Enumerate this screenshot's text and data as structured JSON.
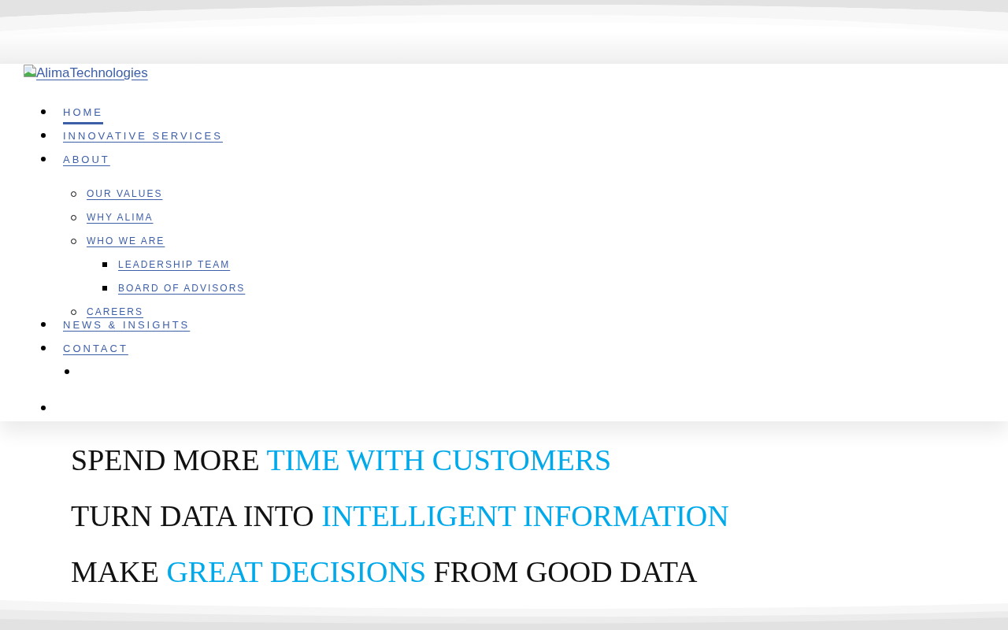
{
  "logo": {
    "alt_text": "AlimaTechnologies"
  },
  "nav": {
    "items": [
      {
        "kind": "link",
        "label": "HOME",
        "selected": true
      },
      {
        "kind": "link",
        "label": "INNOVATIVE SERVICES",
        "selected": false
      },
      {
        "kind": "link",
        "label": "ABOUT",
        "selected": false,
        "children": [
          {
            "kind": "link",
            "label": "OUR VALUES",
            "selected": false
          },
          {
            "kind": "link",
            "label": "WHY ALIMA",
            "selected": false
          },
          {
            "kind": "link",
            "label": "WHO WE ARE",
            "selected": false,
            "children": [
              {
                "kind": "link",
                "label": "LEADERSHIP TEAM",
                "selected": false
              },
              {
                "kind": "link",
                "label": "BOARD OF ADVISORS",
                "selected": false
              }
            ]
          },
          {
            "kind": "link",
            "label": "CAREERS",
            "selected": false
          }
        ]
      },
      {
        "kind": "link",
        "label": "NEWS & INSIGHTS",
        "selected": false
      },
      {
        "kind": "link",
        "label": "CONTACT",
        "selected": false,
        "children": [
          {
            "kind": "blank"
          }
        ]
      },
      {
        "kind": "blank"
      }
    ]
  },
  "headlines": [
    {
      "parts": [
        {
          "text": "SPEND MORE",
          "highlight": false
        },
        {
          "text": "TIME WITH CUSTOMERS",
          "highlight": true
        }
      ]
    },
    {
      "parts": [
        {
          "text": "TURN DATA INTO",
          "highlight": false
        },
        {
          "text": "INTELLIGENT INFORMATION",
          "highlight": true
        }
      ]
    },
    {
      "parts": [
        {
          "text": "MAKE",
          "highlight": false
        },
        {
          "text": "GREAT DECISIONS",
          "highlight": true
        },
        {
          "text": "FROM GOOD DATA",
          "highlight": false
        }
      ]
    }
  ]
}
